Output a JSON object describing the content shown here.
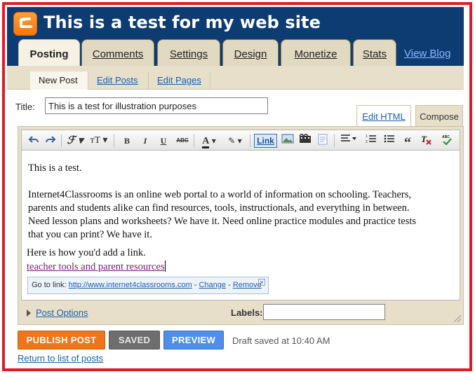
{
  "header": {
    "blog_title": "This is a test for my web site",
    "logo": "blogger-logo-icon",
    "view_blog_label": "View Blog"
  },
  "tabs": [
    {
      "label": "Posting",
      "active": true
    },
    {
      "label": "Comments",
      "active": false
    },
    {
      "label": "Settings",
      "active": false
    },
    {
      "label": "Design",
      "active": false
    },
    {
      "label": "Monetize",
      "active": false
    },
    {
      "label": "Stats",
      "active": false
    }
  ],
  "subnav": {
    "new_post": "New Post",
    "edit_posts": "Edit Posts",
    "edit_pages": "Edit Pages"
  },
  "post": {
    "title_label": "Title:",
    "title_value": "This is a test for illustration purposes"
  },
  "mode_tabs": {
    "edit_html": "Edit HTML",
    "compose": "Compose"
  },
  "toolbar": {
    "link_label": "Link",
    "icons": [
      "undo-icon",
      "redo-icon",
      "font-icon",
      "font-size-icon",
      "bold-icon",
      "italic-icon",
      "underline-icon",
      "strikethrough-icon",
      "text-color-icon",
      "highlight-icon",
      "link-icon",
      "image-icon",
      "video-icon",
      "jump-break-icon",
      "align-icon",
      "numbered-list-icon",
      "bullet-list-icon",
      "quote-icon",
      "remove-formatting-icon",
      "spellcheck-icon"
    ]
  },
  "editor": {
    "para1": "This is a test.",
    "para2": "Internet4Classrooms is an online web portal to a world of information on schooling. Teachers, parents and students alike can find resources, tools, instructionals, and everything in between. Need lesson plans and worksheets? We have it. Need online practice modules and practice tests that you can print? We have it.",
    "para3": "Here is how you'd add a link.",
    "link_text": "teacher tools and parent resources",
    "link_bubble": {
      "go_to_link": "Go to link:",
      "url": "http://www.internet4classrooms.com",
      "sep": "-",
      "change": "Change",
      "remove": "Remove"
    }
  },
  "footer": {
    "post_options": "Post Options",
    "labels_label": "Labels:",
    "labels_value": ""
  },
  "actions": {
    "publish": "PUBLISH POST",
    "saved": "SAVED",
    "preview": "PREVIEW",
    "draft_status": "Draft saved at 10:40 AM",
    "return_link": "Return to list of posts"
  },
  "colors": {
    "header_bg": "#0d3c73",
    "frame_border": "#e21b22",
    "publish": "#f0741a",
    "preview": "#4f8fe9",
    "link": "#1b5fae"
  }
}
